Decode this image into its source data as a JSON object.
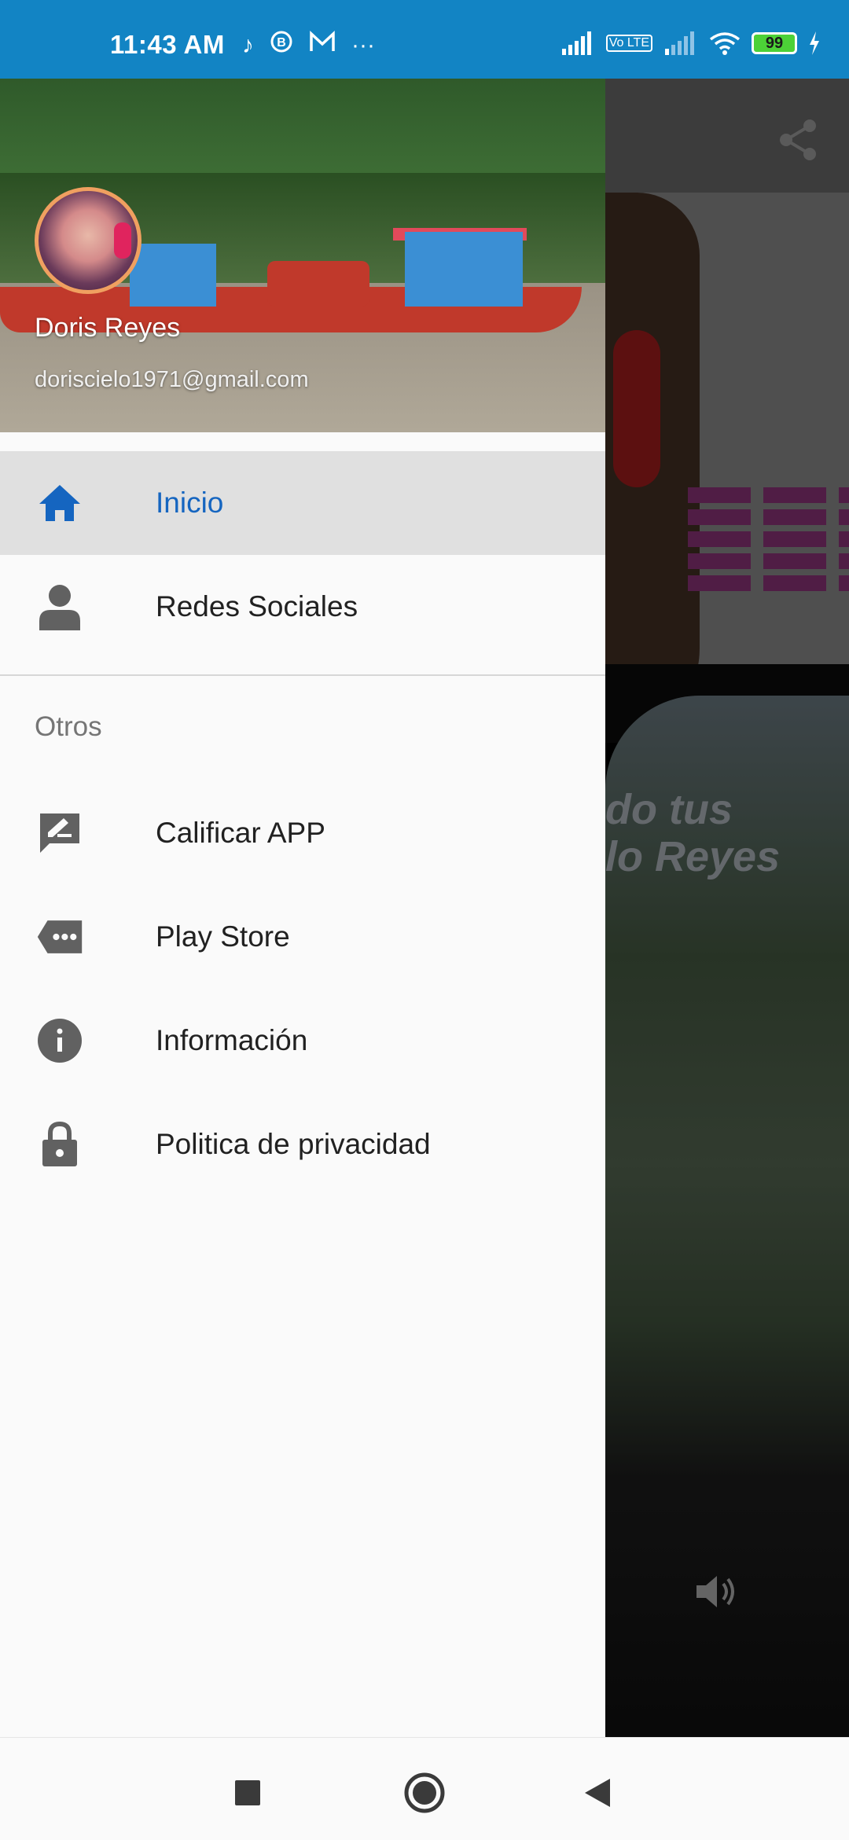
{
  "status_bar": {
    "time": "11:43 AM",
    "notification_icons": [
      "music-note-icon",
      "b-circle-icon",
      "mail-icon",
      "more-dots-icon"
    ],
    "more": "···",
    "lte_badge": "Vo LTE",
    "battery_level": "99",
    "background_color": "#1284c4"
  },
  "drawer": {
    "header": {
      "user_name": "Doris Reyes",
      "user_email": "doriscielo1971@gmail.com"
    },
    "primary_items": [
      {
        "label": "Inicio",
        "icon": "home-icon",
        "active": true
      },
      {
        "label": "Redes Sociales",
        "icon": "person-icon",
        "active": false
      }
    ],
    "section_title": "Otros",
    "secondary_items": [
      {
        "label": "Calificar APP",
        "icon": "rate-review-icon"
      },
      {
        "label": "Play Store",
        "icon": "store-tag-icon"
      },
      {
        "label": "Información",
        "icon": "info-icon"
      },
      {
        "label": "Politica de privacidad",
        "icon": "lock-icon"
      }
    ],
    "accent_color": "#1565c0"
  },
  "background_app": {
    "banner_text_line1": "do tus",
    "banner_text_line2": "lo Reyes"
  },
  "nav_bar": {
    "buttons": [
      "recents-square-icon",
      "home-circle-icon",
      "back-triangle-icon"
    ]
  }
}
